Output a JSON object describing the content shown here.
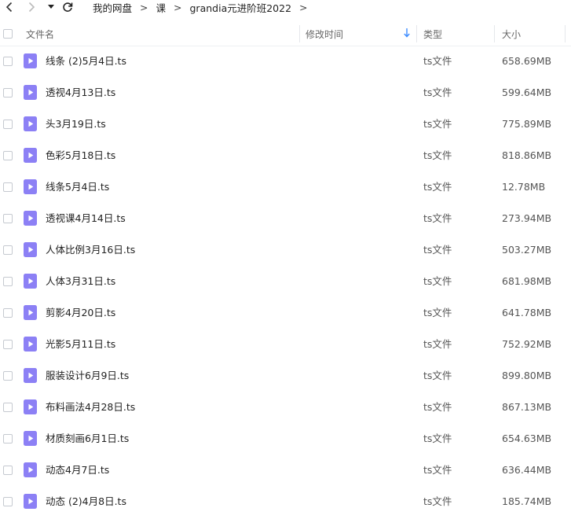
{
  "toolbar": {
    "icons": {
      "back": "chevron-left-icon",
      "forward": "chevron-right-icon",
      "history": "caret-down-icon",
      "refresh": "refresh-icon"
    },
    "breadcrumb": [
      "我的网盘",
      "课",
      "grandia元进阶班2022"
    ],
    "separator": ">"
  },
  "columns": {
    "name": "文件名",
    "modified": "修改时间",
    "type": "类型",
    "size": "大小"
  },
  "colors": {
    "accent": "#3b8bff",
    "file_icon": "#8c80f5"
  },
  "files": [
    {
      "name": "线条 (2)5月4日.ts",
      "type": "ts文件",
      "size": "658.69MB"
    },
    {
      "name": "透视4月13日.ts",
      "type": "ts文件",
      "size": "599.64MB"
    },
    {
      "name": "头3月19日.ts",
      "type": "ts文件",
      "size": "775.89MB"
    },
    {
      "name": "色彩5月18日.ts",
      "type": "ts文件",
      "size": "818.86MB"
    },
    {
      "name": "线条5月4日.ts",
      "type": "ts文件",
      "size": "12.78MB"
    },
    {
      "name": "透视课4月14日.ts",
      "type": "ts文件",
      "size": "273.94MB"
    },
    {
      "name": "人体比例3月16日.ts",
      "type": "ts文件",
      "size": "503.27MB"
    },
    {
      "name": "人体3月31日.ts",
      "type": "ts文件",
      "size": "681.98MB"
    },
    {
      "name": "剪影4月20日.ts",
      "type": "ts文件",
      "size": "641.78MB"
    },
    {
      "name": "光影5月11日.ts",
      "type": "ts文件",
      "size": "752.92MB"
    },
    {
      "name": "服装设计6月9日.ts",
      "type": "ts文件",
      "size": "899.80MB"
    },
    {
      "name": "布料画法4月28日.ts",
      "type": "ts文件",
      "size": "867.13MB"
    },
    {
      "name": "材质刻画6月1日.ts",
      "type": "ts文件",
      "size": "654.63MB"
    },
    {
      "name": "动态4月7日.ts",
      "type": "ts文件",
      "size": "636.44MB"
    },
    {
      "name": "动态 (2)4月8日.ts",
      "type": "ts文件",
      "size": "185.74MB"
    }
  ]
}
